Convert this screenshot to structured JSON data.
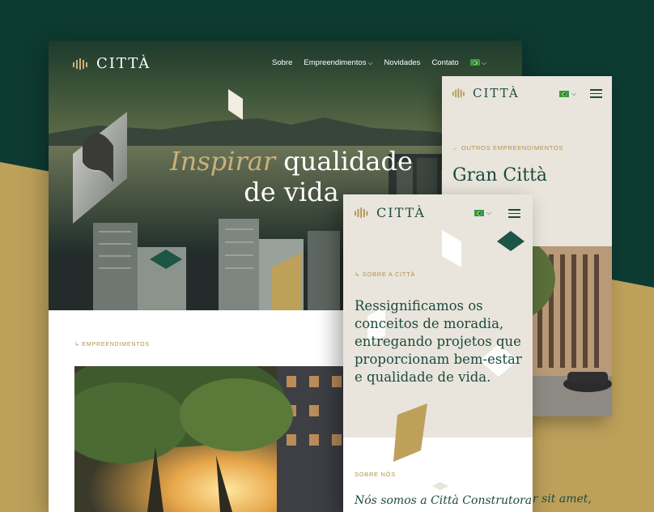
{
  "brand": {
    "name": "CITTÀ"
  },
  "desktop": {
    "nav": {
      "items": [
        "Sobre",
        "Empreendimentos",
        "Novidades",
        "Contato"
      ]
    },
    "hero": {
      "headline_italic": "Inspirar",
      "headline_rest": "qualidade",
      "headline_line2": "de vida"
    },
    "section_label": "↳ EMPREENDIMENTOS"
  },
  "mobile_project": {
    "breadcrumb": "←  OUTROS EMPREENDIMENTOS",
    "title": "Gran Città"
  },
  "mobile_about": {
    "breadcrumb": "↳ SOBRE A CITTÀ",
    "statement": "Ressignificamos os conceitos de moradia, entregando projetos que proporcionam bem-estar e qualidade de vida.",
    "section_label": "SOBRE NÓS",
    "subtitle": "Nós somos a Città Construtora"
  },
  "lorem_fragment": "r sit amet,",
  "colors": {
    "deep_green": "#0d3a31",
    "brand_green": "#1c4a3f",
    "gold": "#b0924a",
    "cream": "#e9e5dc"
  },
  "icons": [
    "logo-mark-icon",
    "flag-brazil-icon",
    "chevron-down-icon",
    "hamburger-menu-icon",
    "arrow-left-icon"
  ]
}
